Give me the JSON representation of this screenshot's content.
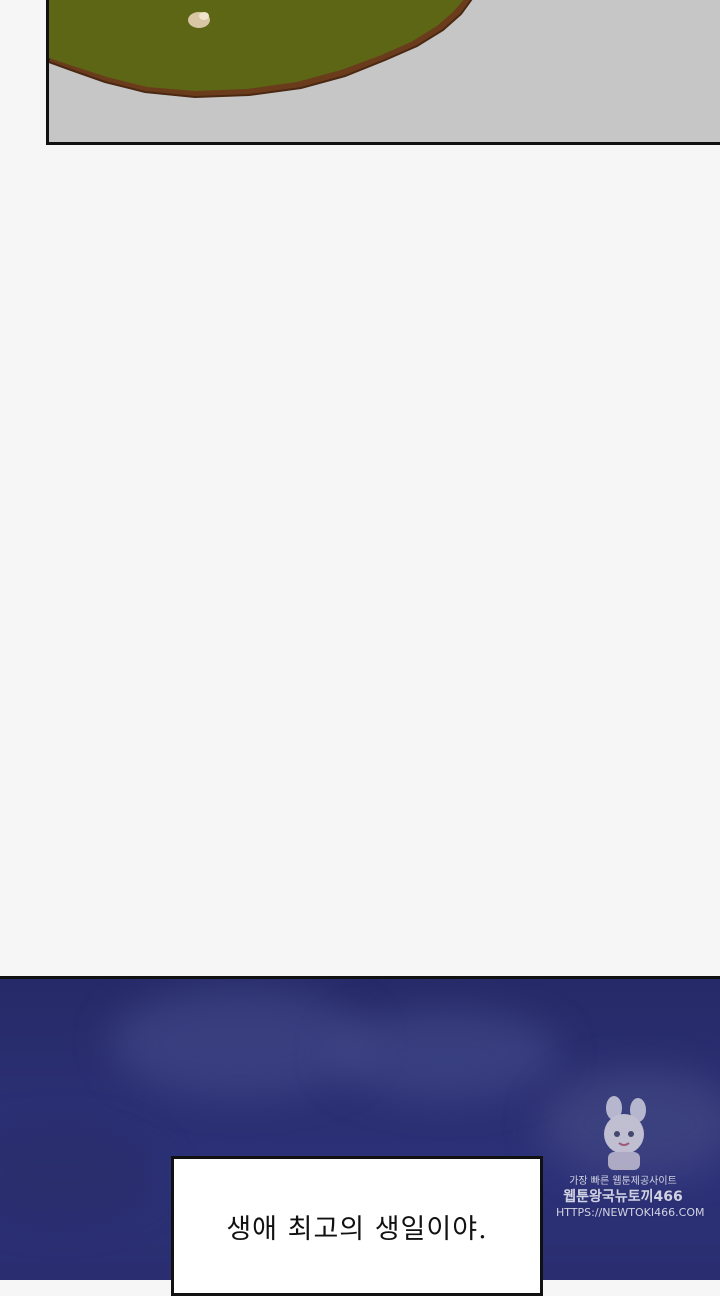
{
  "caption": {
    "text": "생애 최고의 생일이야."
  },
  "watermark": {
    "tagline": "가장 빠른 웹툰제공사이트",
    "site_name": "웹툰왕국뉴토끼466",
    "url": "HTTPS://NEWTOKI466.COM"
  },
  "colors": {
    "page_background": "#f6f6f6",
    "top_panel_background": "#c6c6c6",
    "bowl_color": "#5d6614",
    "bowl_rim": "#6b3c1c",
    "night_sky": "#2a2f72",
    "border": "#111111",
    "caption_background": "#ffffff"
  },
  "icons": [
    "bowl-illustration",
    "rabbit-mascot-icon"
  ]
}
